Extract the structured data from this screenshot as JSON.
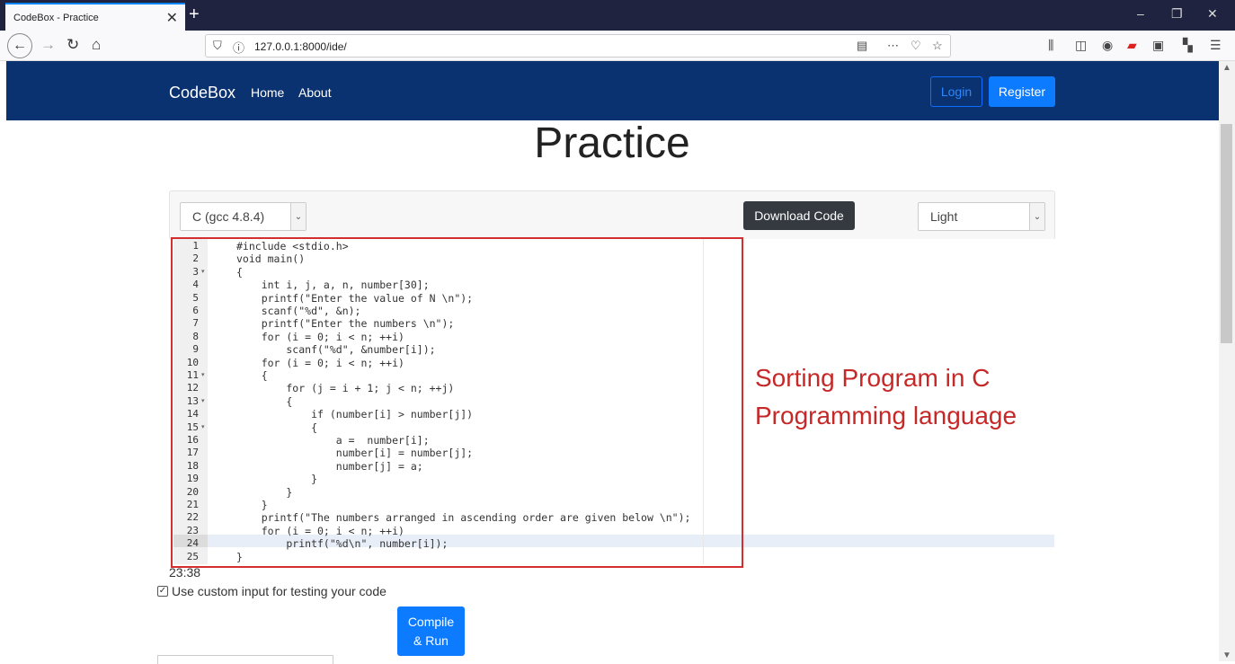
{
  "browser": {
    "tab_title": "CodeBox - Practice",
    "url": "127.0.0.1:8000/ide/"
  },
  "site": {
    "brand": "CodeBox",
    "nav": [
      "Home",
      "About"
    ],
    "login_label": "Login",
    "register_label": "Register"
  },
  "page": {
    "title": "Practice",
    "language_selected": "C (gcc 4.8.4)",
    "download_label": "Download Code",
    "theme_selected": "Light",
    "cursor_position": "23:38",
    "custom_input_label": "Use custom input for testing your code",
    "compile_label_1": "Compile",
    "compile_label_2": "& Run"
  },
  "annotation": {
    "line1": "Sorting Program in C",
    "line2": "Programming language"
  },
  "code_lines": [
    "#include <stdio.h>",
    "void main()",
    "{",
    "    int i, j, a, n, number[30];",
    "    printf(\"Enter the value of N \\n\");",
    "    scanf(\"%d\", &n);",
    "    printf(\"Enter the numbers \\n\");",
    "    for (i = 0; i < n; ++i)",
    "        scanf(\"%d\", &number[i]);",
    "    for (i = 0; i < n; ++i)",
    "    {",
    "        for (j = i + 1; j < n; ++j)",
    "        {",
    "            if (number[i] > number[j])",
    "            {",
    "                a =  number[i];",
    "                number[i] = number[j];",
    "                number[j] = a;",
    "            }",
    "        }",
    "    }",
    "    printf(\"The numbers arranged in ascending order are given below \\n\");",
    "    for (i = 0; i < n; ++i)",
    "        printf(\"%d\\n\", number[i]);",
    "}"
  ],
  "fold_lines": [
    3,
    11,
    13,
    15
  ],
  "colors": {
    "navbar": "#0b3270",
    "primary": "#0d7bff",
    "annotation": "#c62828"
  }
}
